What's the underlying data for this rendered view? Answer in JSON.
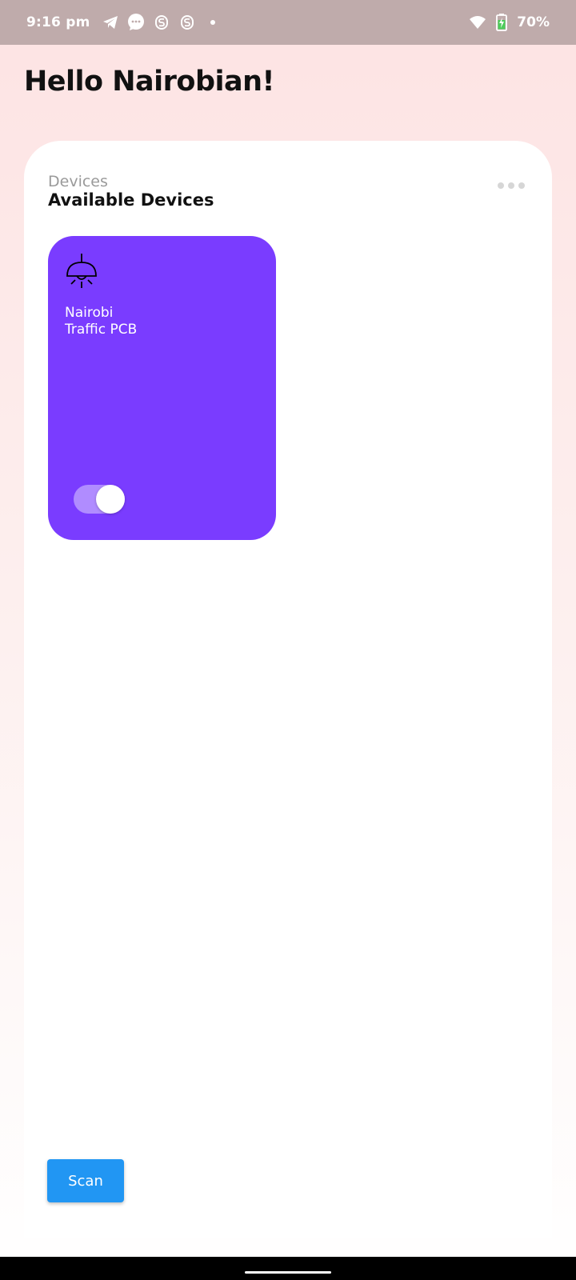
{
  "status_bar": {
    "time": "9:16 pm",
    "battery": "70%",
    "icons": [
      "telegram-icon",
      "messages-icon",
      "s-app-icon",
      "s-app-icon",
      "dot-icon",
      "wifi-icon",
      "battery-charging-icon"
    ]
  },
  "greeting": "Hello Nairobian!",
  "devices": {
    "subtitle": "Devices",
    "title": "Available Devices",
    "items": [
      {
        "name_line1": "Nairobi",
        "name_line2": "Traffic PCB",
        "icon": "ceiling-lamp-icon",
        "on": true,
        "color": "#7a3cff"
      }
    ]
  },
  "scan_label": "Scan",
  "colors": {
    "status_bar": "#bfabab",
    "accent": "#7a3cff",
    "scan_button": "#2196f3"
  }
}
